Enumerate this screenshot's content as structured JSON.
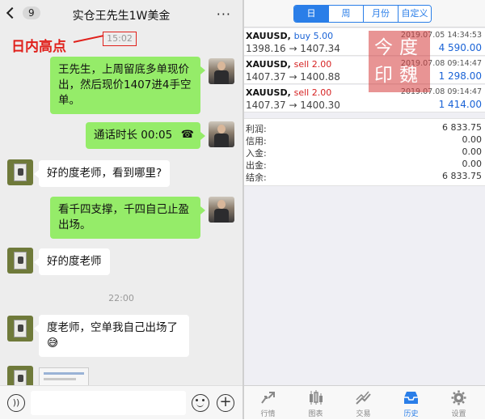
{
  "chat": {
    "back_badge": "9",
    "title": "实仓王先生1W美金",
    "more_label": "···",
    "annotation": "日内高点",
    "time_top": "15:02",
    "time_mid": "22:00",
    "messages": [
      {
        "side": "me",
        "text": "王先生，上周留底多单现价出，然后现价1407进4手空单。"
      },
      {
        "side": "me",
        "text": "通话时长 00:05"
      },
      {
        "side": "other",
        "text": "好的度老师，看到哪里?"
      },
      {
        "side": "me",
        "text": "看千四支撑，千四自己止盈出场。"
      },
      {
        "side": "other",
        "text": "好的度老师"
      },
      {
        "side": "other",
        "text": "度老师，空单我自己出场了😅"
      }
    ],
    "call_icon": "☎"
  },
  "app": {
    "segments": [
      "日",
      "周",
      "月份",
      "自定义"
    ],
    "active_segment": 0,
    "accent": "#2a7ee8",
    "deals": [
      {
        "symbol": "XAUUSD,",
        "side": "buy 5.00",
        "side_type": "buy",
        "datetime": "2019.07.05 14:34:53",
        "prices": "1398.16 → 1407.34",
        "profit": "4 590.00"
      },
      {
        "symbol": "XAUUSD,",
        "side": "sell 2.00",
        "side_type": "sell",
        "datetime": "2019.07.08 09:14:47",
        "prices": "1407.37 → 1400.88",
        "profit": "1 298.00"
      },
      {
        "symbol": "XAUUSD,",
        "side": "sell 2.00",
        "side_type": "sell",
        "datetime": "2019.07.08 09:14:47",
        "prices": "1407.37 → 1400.30",
        "profit": "1 414.00"
      }
    ],
    "stamp": "今度印魏",
    "summary": [
      {
        "label": "利润:",
        "value": "6 833.75"
      },
      {
        "label": "信用:",
        "value": "0.00"
      },
      {
        "label": "入金:",
        "value": "0.00"
      },
      {
        "label": "出金:",
        "value": "0.00"
      },
      {
        "label": "结余:",
        "value": "6 833.75"
      }
    ],
    "tabs": [
      {
        "label": "行情",
        "icon": "quotes-icon"
      },
      {
        "label": "图表",
        "icon": "chart-icon"
      },
      {
        "label": "交易",
        "icon": "trade-icon"
      },
      {
        "label": "历史",
        "icon": "history-icon"
      },
      {
        "label": "设置",
        "icon": "settings-icon"
      }
    ],
    "active_tab": 3
  }
}
